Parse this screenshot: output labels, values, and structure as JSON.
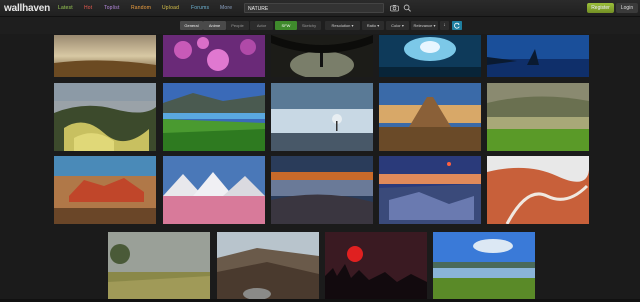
{
  "header": {
    "logo": "wallhaven",
    "nav": [
      "Latest",
      "Hot",
      "Toplist",
      "Random",
      "Upload",
      "Forums",
      "More"
    ],
    "search_value": "NATURE",
    "register_label": "Register",
    "login_label": "Login"
  },
  "filters": {
    "categories": [
      "General",
      "Anime",
      "People",
      "Actor"
    ],
    "purity": [
      "SFW",
      "Sketchy"
    ],
    "dropdowns": [
      "Resolution ▾",
      "Ratio ▾",
      "Color ▾",
      "Relevance ▾"
    ],
    "order": "↓"
  },
  "colors": {
    "accent_green": "#9bbf3a",
    "sfw_green": "#3f8a2c",
    "refresh_blue": "#1f7fa0"
  },
  "thumbnails": [
    {
      "name": "thumb-prairie-sunset"
    },
    {
      "name": "thumb-purple-flowers"
    },
    {
      "name": "thumb-dark-tree-arch"
    },
    {
      "name": "thumb-ice-cave"
    },
    {
      "name": "thumb-blue-lake"
    },
    {
      "name": "thumb-striped-hills"
    },
    {
      "name": "thumb-coast-hills"
    },
    {
      "name": "thumb-misty-tree"
    },
    {
      "name": "thumb-desert-butte"
    },
    {
      "name": "thumb-lake-meadow"
    },
    {
      "name": "thumb-red-rocks"
    },
    {
      "name": "thumb-salt-pink-lake"
    },
    {
      "name": "thumb-cloud-sea"
    },
    {
      "name": "thumb-rocky-shore-night"
    },
    {
      "name": "thumb-red-canyon"
    },
    {
      "name": "thumb-foggy-field"
    },
    {
      "name": "thumb-mountain-valley"
    },
    {
      "name": "thumb-red-moon-forest"
    },
    {
      "name": "thumb-green-wetland"
    }
  ]
}
